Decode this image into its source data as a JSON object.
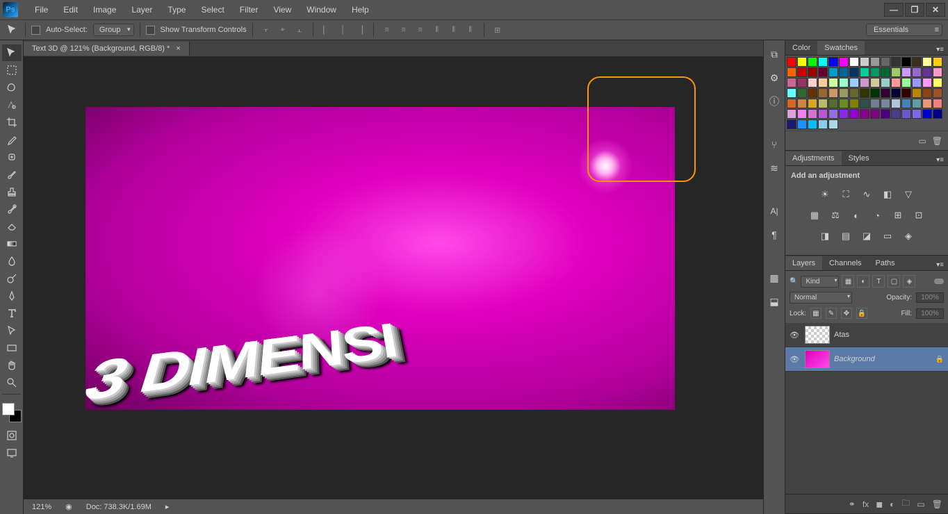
{
  "menu": [
    "File",
    "Edit",
    "Image",
    "Layer",
    "Type",
    "Select",
    "Filter",
    "View",
    "Window",
    "Help"
  ],
  "options": {
    "auto_select": "Auto-Select:",
    "group": "Group",
    "show_transform": "Show Transform Controls",
    "workspace": "Essentials"
  },
  "doc_tab": "Text 3D @ 121% (Background, RGB/8) *",
  "canvas_text": "3 DIMENSI",
  "status": {
    "zoom": "121%",
    "doc": "Doc: 738.3K/1.69M"
  },
  "panels": {
    "color_tabs": [
      "Color",
      "Swatches"
    ],
    "adjust_tabs": [
      "Adjustments",
      "Styles"
    ],
    "adjust_title": "Add an adjustment",
    "layer_tabs": [
      "Layers",
      "Channels",
      "Paths"
    ],
    "layer_filter": "Kind",
    "blend_mode": "Normal",
    "opacity_label": "Opacity:",
    "opacity_val": "100%",
    "lock_label": "Lock:",
    "fill_label": "Fill:",
    "fill_val": "100%"
  },
  "layers": [
    {
      "name": "Atas",
      "thumb": "checker",
      "selected": false,
      "locked": false
    },
    {
      "name": "Background",
      "thumb": "magenta",
      "selected": true,
      "locked": true,
      "italic": true
    }
  ],
  "swatch_colors": [
    "#ff0000",
    "#ffff00",
    "#00ff00",
    "#00ffff",
    "#0000ff",
    "#ff00ff",
    "#ffffff",
    "#cccccc",
    "#999999",
    "#666666",
    "#333333",
    "#000000",
    "#3a2e1e",
    "#ffff99",
    "#ffcc00",
    "#ff6600",
    "#cc0000",
    "#990000",
    "#660033",
    "#0099cc",
    "#006699",
    "#003366",
    "#00cc99",
    "#009966",
    "#006633",
    "#99cc66",
    "#cc99ff",
    "#9966cc",
    "#663399",
    "#ff99cc",
    "#cc6699",
    "#993366",
    "#ffcccc",
    "#ffcc99",
    "#ccff99",
    "#99ffcc",
    "#99ccff",
    "#cc99cc",
    "#cccc99",
    "#99cccc",
    "#ff9999",
    "#99ff99",
    "#9999ff",
    "#ff99ff",
    "#ffff66",
    "#66ffff",
    "#336633",
    "#663300",
    "#996633",
    "#cc9966",
    "#999966",
    "#666633",
    "#333300",
    "#003300",
    "#330033",
    "#000033",
    "#330000",
    "#b8860b",
    "#8b4513",
    "#a0522d",
    "#d2691e",
    "#cd853f",
    "#daa520",
    "#bdb76b",
    "#556b2f",
    "#6b8e23",
    "#808000",
    "#2f4f4f",
    "#708090",
    "#778899",
    "#b0c4de",
    "#4682b4",
    "#5f9ea0",
    "#e9967a",
    "#f08080",
    "#dda0dd",
    "#ee82ee",
    "#da70d6",
    "#ba55d3",
    "#9370db",
    "#8a2be2",
    "#9400d3",
    "#8b008b",
    "#800080",
    "#4b0082",
    "#483d8b",
    "#6a5acd",
    "#7b68ee",
    "#0000cd",
    "#00008b",
    "#191970",
    "#1e90ff",
    "#00bfff",
    "#87ceeb",
    "#add8e6"
  ]
}
